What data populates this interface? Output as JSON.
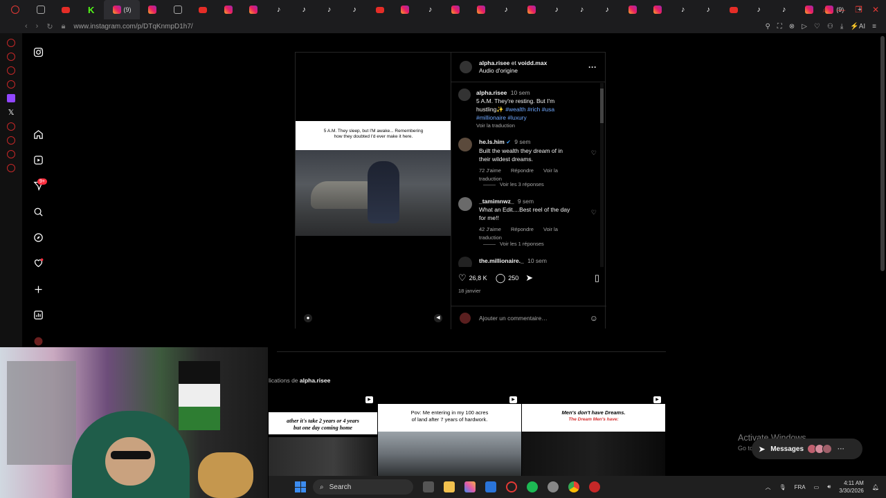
{
  "browser": {
    "tabs": [
      {
        "icon": "opera-icon"
      },
      {
        "icon": "workspace-icon"
      },
      {
        "icon": "youtube-icon"
      },
      {
        "icon": "kick-icon",
        "glyph": "K"
      },
      {
        "icon": "instagram-icon",
        "active": true,
        "count": "(9)"
      },
      {
        "icon": "instagram-icon"
      },
      {
        "icon": "document-icon"
      },
      {
        "icon": "youtube-icon"
      },
      {
        "icon": "instagram-icon"
      },
      {
        "icon": "instagram-icon"
      },
      {
        "icon": "tiktok-icon"
      },
      {
        "icon": "tiktok-icon"
      },
      {
        "icon": "tiktok-icon"
      },
      {
        "icon": "tiktok-icon"
      },
      {
        "icon": "youtube-icon"
      },
      {
        "icon": "instagram-icon"
      },
      {
        "icon": "tiktok-icon"
      },
      {
        "icon": "instagram-icon"
      },
      {
        "icon": "instagram-icon"
      },
      {
        "icon": "tiktok-icon"
      },
      {
        "icon": "instagram-icon"
      },
      {
        "icon": "tiktok-icon"
      },
      {
        "icon": "tiktok-icon"
      },
      {
        "icon": "tiktok-icon"
      },
      {
        "icon": "instagram-icon"
      },
      {
        "icon": "instagram-icon"
      },
      {
        "icon": "tiktok-icon"
      },
      {
        "icon": "tiktok-icon"
      },
      {
        "icon": "youtube-icon"
      },
      {
        "icon": "tiktok-icon"
      },
      {
        "icon": "tiktok-icon"
      },
      {
        "icon": "instagram-icon"
      },
      {
        "icon": "instagram-icon",
        "count": "(9)"
      }
    ],
    "active_tab_count": "(9)",
    "last_tab_count": "(9)",
    "url": "www.instagram.com/p/DTqKnmpD1h7/",
    "ai_label": "AI"
  },
  "post": {
    "header": {
      "user1": "alpha.risee",
      "joiner": "et",
      "user2": "voidd.max",
      "audio": "Audio d'origine"
    },
    "reel_caption_line1": "5 A.M. They sleep, but I'M awake... Remembering",
    "reel_caption_line2": "how they doubted I'd ever make it here.",
    "owner_comment": {
      "user": "alpha.risee",
      "time": "10 sem",
      "text_line1": "5 A.M. They're resting. But I'm",
      "text_line2": "hustling✨",
      "tags_line2": "#wealth #rich #usa",
      "tags_line3": "#millionaire #luxury",
      "translate": "Voir la traduction"
    },
    "comments": [
      {
        "user": "he.ls.him",
        "verified": true,
        "time": "9 sem",
        "line1": "Built the wealth they dream of in",
        "line2": "their wildest dreams.",
        "likes": "72 J'aime",
        "reply": "Répondre",
        "translate": "Voir la traduction",
        "replies": "Voir les 3 réponses"
      },
      {
        "user": "_tamimnwz_",
        "time": "9 sem",
        "line1": "What an Edit....Best reel of the day",
        "line2": "for me!!",
        "likes": "42 J'aime",
        "reply": "Répondre",
        "translate": "Voir la traduction",
        "replies": "Voir les 1 réponses"
      },
      {
        "user": "the.millionaire._",
        "time": "10 sem"
      }
    ],
    "likes": "26,8 K",
    "comments_count": "250",
    "date": "18 janvier",
    "add_comment_placeholder": "Ajouter un commentaire…"
  },
  "more": {
    "prefix": "lications de",
    "user": "alpha.risee",
    "thumbs": [
      {
        "line1": "ather it's take 2 years or 4 years",
        "line2": "but one day coming home"
      },
      {
        "line1": "Pov: Me entering in my 100 acres",
        "line2": "of land after 7 years of hardwork."
      },
      {
        "line1": "Men's don't have Dreams.",
        "line2": "The Dream Men's have:"
      }
    ]
  },
  "taskbar": {
    "search": "Search",
    "lang": "FRA",
    "time": "4:11 AM",
    "date": "3/30/2026"
  },
  "overlay": {
    "activate_title": "Activate Windows",
    "activate_sub": "Go to",
    "messages": "Messages",
    "messages_badge": "9+"
  },
  "ig_badge": "9+"
}
